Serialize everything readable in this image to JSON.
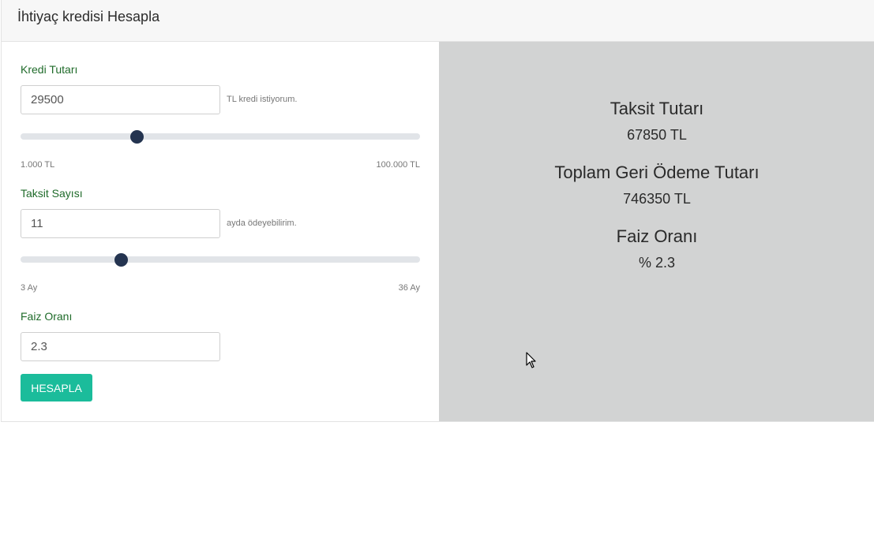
{
  "header": {
    "title": "İhtiyaç kredisi Hesapla"
  },
  "form": {
    "amount": {
      "label": "Kredi Tutarı",
      "value": "29500",
      "helper": "TL kredi istiyorum.",
      "range_min": "1.000 TL",
      "range_max": "100.000 TL",
      "slider_fraction": 0.29
    },
    "installments": {
      "label": "Taksit Sayısı",
      "value": "11",
      "helper": "ayda ödeyebilirim.",
      "range_min": "3 Ay",
      "range_max": "36 Ay",
      "slider_fraction": 0.25
    },
    "rate": {
      "label": "Faiz Oranı",
      "value": "2.3"
    },
    "submit_label": "HESAPLA"
  },
  "results": {
    "installment": {
      "title": "Taksit Tutarı",
      "value": "67850 TL"
    },
    "total": {
      "title": "Toplam Geri Ödeme Tutarı",
      "value": "746350 TL"
    },
    "rate": {
      "title": "Faiz Oranı",
      "value": "% 2.3"
    }
  },
  "colors": {
    "label_green": "#1f6b2a",
    "button_teal": "#1bbc9b",
    "slider_thumb": "#243450",
    "result_bg": "#d2d3d3"
  }
}
